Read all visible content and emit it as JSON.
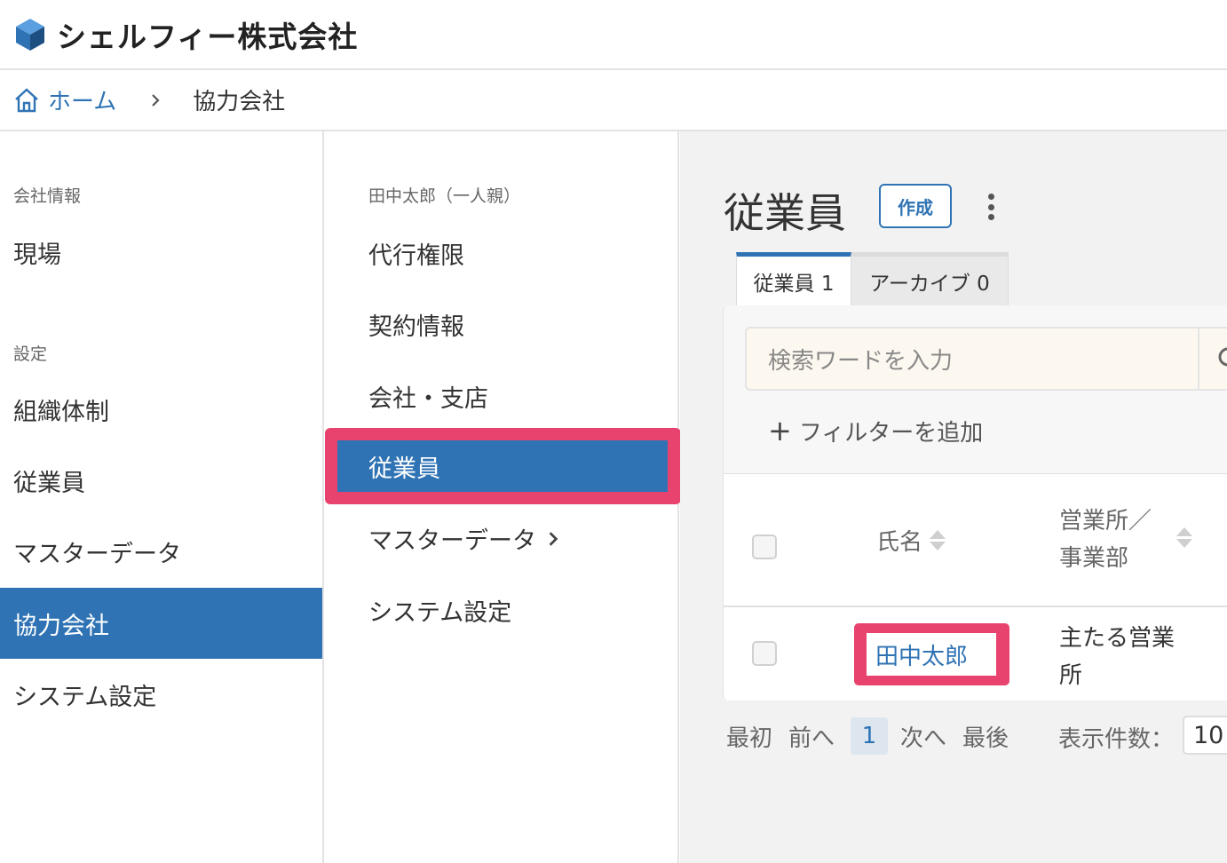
{
  "header": {
    "company_name": "シェルフィー株式会社"
  },
  "breadcrumb": {
    "home": "ホーム",
    "current": "協力会社"
  },
  "sidebar": {
    "section_company": "会社情報",
    "item_site": "現場",
    "section_settings": "設定",
    "item_org": "組織体制",
    "item_employees": "従業員",
    "item_master": "マスターデータ",
    "item_partners": "協力会社",
    "item_system": "システム設定"
  },
  "submenu": {
    "section": "田中太郎（一人親）",
    "item_proxy": "代行権限",
    "item_contract": "契約情報",
    "item_branch": "会社・支店",
    "item_employees": "従業員",
    "item_master": "マスターデータ",
    "item_system": "システム設定"
  },
  "main": {
    "title": "従業員",
    "create_label": "作成",
    "tabs": [
      {
        "label": "従業員 1"
      },
      {
        "label": "アーカイブ 0"
      }
    ],
    "search_placeholder": "検索ワードを入力",
    "add_filter": "フィルターを追加",
    "table": {
      "col_name": "氏名",
      "col_office": "営業所／事業部",
      "rows": [
        {
          "name": "田中太郎",
          "office": "主たる営業所"
        }
      ]
    },
    "pager": {
      "first": "最初",
      "prev": "前へ",
      "current": "1",
      "next": "次へ",
      "last": "最後",
      "per_page_label": "表示件数：",
      "per_page_value": "10"
    }
  },
  "colors": {
    "accent": "#2f73b4",
    "highlight": "#e8436f",
    "search_bg": "#fdf8ef"
  }
}
